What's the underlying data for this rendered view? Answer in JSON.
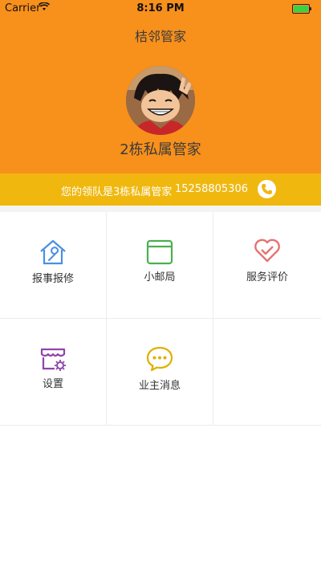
{
  "status_bar": {
    "carrier": "Carrier",
    "time": "8:16 PM"
  },
  "header": {
    "title": "桔邻管家",
    "manager_name": "2栋私属管家"
  },
  "info_bar": {
    "text": "您的领队是3栋私属管家",
    "phone": "15258805306"
  },
  "grid": {
    "items": [
      {
        "label": "报事报修",
        "icon": "house-wrench-icon",
        "color": "#4a90e2"
      },
      {
        "label": "小邮局",
        "icon": "mailbox-icon",
        "color": "#4caf50"
      },
      {
        "label": "服务评价",
        "icon": "heart-check-icon",
        "color": "#e57373"
      },
      {
        "label": "设置",
        "icon": "store-gear-icon",
        "color": "#8e44ad"
      },
      {
        "label": "业主消息",
        "icon": "chat-bubble-icon",
        "color": "#e0b000"
      }
    ]
  },
  "colors": {
    "header": "#f8901c",
    "info_bar": "#f0b80f"
  }
}
